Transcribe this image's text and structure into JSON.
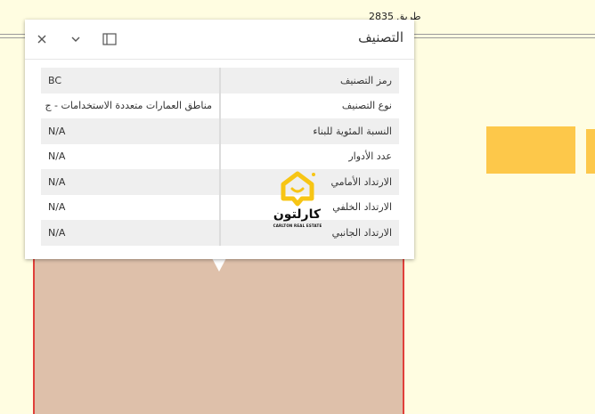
{
  "map": {
    "road_label": "طريق 2835"
  },
  "popup": {
    "title": "التصنيف",
    "rows": [
      {
        "label": "رمز التصنيف",
        "value": "BC"
      },
      {
        "label": "نوع التصنيف",
        "value": "مناطق العمارات متعددة الاستخدامات - ج"
      },
      {
        "label": "النسبة المئوية للبناء",
        "value": "N/A"
      },
      {
        "label": "عدد الأدوار",
        "value": "N/A"
      },
      {
        "label": "الارتداد الأمامي",
        "value": "N/A"
      },
      {
        "label": "الارتداد الخلفي",
        "value": "N/A"
      },
      {
        "label": "الارتداد الجانبي",
        "value": "N/A"
      }
    ]
  },
  "watermark": {
    "brand_name": "كارلتون",
    "tagline": "CARLTON REAL ESTATE"
  },
  "colors": {
    "map_background": "#fffde1",
    "parcel_fill": "#dec0aa",
    "parcel_border": "#e0403a",
    "building_fill": "#fdc84a",
    "logo_accent": "#f7c514"
  }
}
